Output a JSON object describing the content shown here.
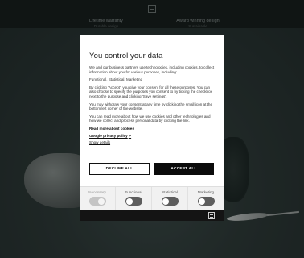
{
  "background": {
    "features": [
      {
        "title": "Lifetime warranty",
        "subtitle": "Durable design"
      },
      {
        "title": "Award winning design",
        "subtitle": "Sustainable"
      }
    ]
  },
  "dialog": {
    "title": "You control your data",
    "intro": "We and our business partners use technologies, including cookies, to collect information about you for various purposes, including:",
    "purposes_list": "Functional, Statistical, Marketing",
    "accept_info": "By clicking 'Accept', you give your consent for all these purposes. You can also choose to specify the purposes you consent to by ticking the checkbox next to the purpose and clicking 'Save settings'.",
    "withdraw_info": "You may withdraw your consent at any time by clicking the small icon at the bottom left corner of the website.",
    "read_more_info": "You can read more about how we use cookies and other technologies and how we collect and process personal data by clicking the link.",
    "links": {
      "cookies": "Read more about cookies",
      "privacy": "Google privacy policy",
      "details": "Show details"
    },
    "buttons": {
      "decline": "DECLINE ALL",
      "accept": "ACCEPT ALL"
    },
    "toggles": [
      {
        "label": "Necessary",
        "on": true,
        "disabled": true
      },
      {
        "label": "Functional",
        "on": false,
        "disabled": false
      },
      {
        "label": "Statistical",
        "on": false,
        "disabled": false
      },
      {
        "label": "Marketing",
        "on": false,
        "disabled": false
      }
    ]
  }
}
